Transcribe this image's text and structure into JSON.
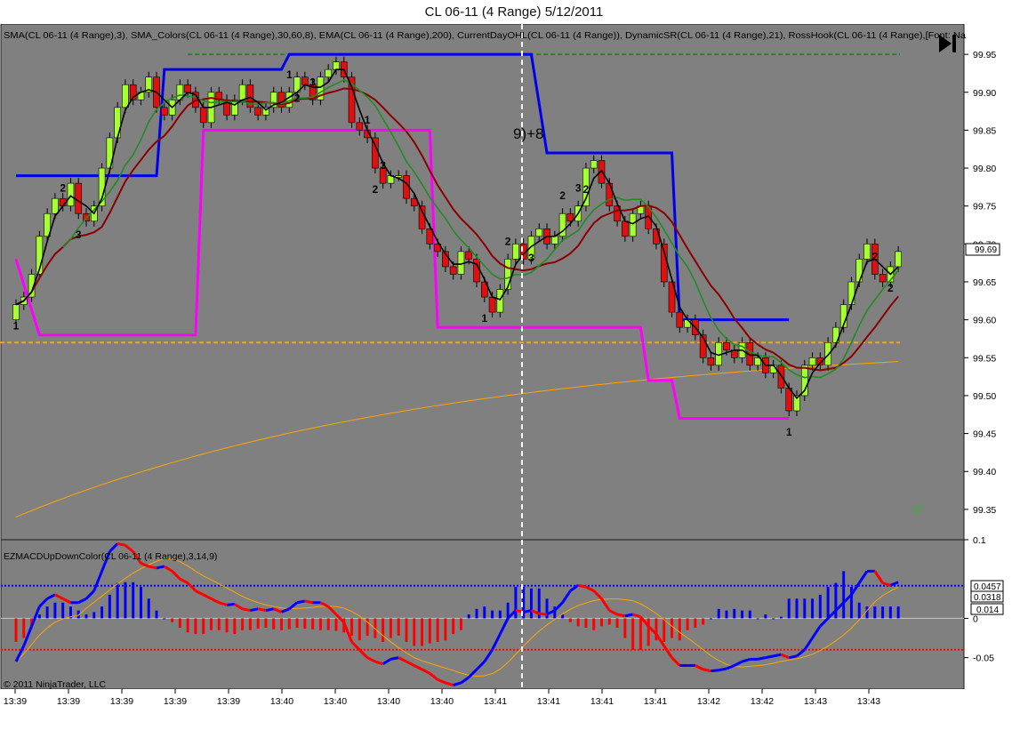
{
  "title": "CL 06-11 (4 Range)  5/12/2011",
  "price_panel": {
    "indicator_legend": "SMA(CL 06-11 (4 Range),3), SMA_Colors(CL 06-11 (4 Range),30,60,8), EMA(CL 06-11 (4 Range),200), CurrentDayOHL(CL 06-11 (4 Range)), DynamicSR(CL 06-11 (4 Range),21), RossHook(CL 06-11 (4 Range),[Font: Na",
    "play_icon": "skip-to-end-icon",
    "annotation": "9)+8",
    "corner_label": "0\"",
    "current_price": "99.69",
    "y_ticks": [
      "99.95",
      "99.90",
      "99.85",
      "99.80",
      "99.75",
      "99.70",
      "99.65",
      "99.60",
      "99.55",
      "99.50",
      "99.45",
      "99.40",
      "99.35"
    ]
  },
  "macd_panel": {
    "legend": "EZMACDUpDownColor(CL 06-11 (4 Range),3,14,9)",
    "copyright": "© 2011 NinjaTrader, LLC",
    "y_ticks": [
      "0.1",
      "0",
      "-0.05"
    ],
    "value_boxes": [
      "0.0457",
      "0.0318",
      "0.014"
    ]
  },
  "x_ticks": [
    "13:39",
    "13:39",
    "13:39",
    "13:39",
    "13:39",
    "13:40",
    "13:40",
    "13:40",
    "13:40",
    "13:41",
    "13:41",
    "13:41",
    "13:41",
    "13:42",
    "13:42",
    "13:43",
    "13:43"
  ],
  "colors": {
    "background": "#808080",
    "up_bar": "#a6ff2e",
    "down_bar": "#e01010",
    "sma_fast": "#000000",
    "sma_colors": "#ffffff",
    "ema200": "#ffa500",
    "day_high": "#228b22",
    "day_open": "#ffa500",
    "resistance": "#0000ee",
    "support": "#ff00ff",
    "macd": "#0000ff",
    "macd_down": "#ff0000"
  },
  "chart_data": {
    "type": "candlestick",
    "ylim": [
      99.31,
      99.99
    ],
    "closes": [
      99.62,
      99.63,
      99.66,
      99.71,
      99.74,
      99.76,
      99.75,
      99.78,
      99.74,
      99.73,
      99.75,
      99.8,
      99.84,
      99.88,
      99.91,
      99.89,
      99.9,
      99.92,
      99.88,
      99.87,
      99.89,
      99.91,
      99.9,
      99.88,
      99.86,
      99.9,
      99.89,
      99.87,
      99.89,
      99.91,
      99.88,
      99.87,
      99.88,
      99.9,
      99.88,
      99.9,
      99.92,
      99.91,
      99.89,
      99.92,
      99.93,
      99.94,
      99.92,
      99.86,
      99.85,
      99.84,
      99.8,
      99.78,
      99.79,
      99.79,
      99.76,
      99.75,
      99.72,
      99.7,
      99.69,
      99.67,
      99.66,
      99.69,
      99.68,
      99.65,
      99.63,
      99.61,
      99.64,
      99.68,
      99.7,
      99.68,
      99.71,
      99.72,
      99.7,
      99.71,
      99.74,
      99.73,
      99.75,
      99.8,
      99.81,
      99.78,
      99.75,
      99.73,
      99.71,
      99.74,
      99.75,
      99.72,
      99.7,
      99.65,
      99.61,
      99.59,
      99.6,
      99.58,
      99.55,
      99.54,
      99.57,
      99.56,
      99.55,
      99.57,
      99.54,
      99.55,
      99.53,
      99.54,
      99.51,
      99.48,
      99.5,
      99.54,
      99.55,
      99.54,
      99.57,
      99.59,
      99.62,
      99.65,
      99.68,
      99.7,
      99.66,
      99.65,
      99.67,
      99.69
    ],
    "series": [
      {
        "name": "SMA 3"
      },
      {
        "name": "SMA_Colors"
      },
      {
        "name": "EMA 200"
      },
      {
        "name": "DynamicSR resistance",
        "levels": [
          [
            0,
            99.79
          ],
          [
            18,
            99.79
          ],
          [
            19,
            99.93
          ],
          [
            34,
            99.93
          ],
          [
            35,
            99.95
          ],
          [
            66,
            99.95
          ],
          [
            68,
            99.82
          ],
          [
            84,
            99.82
          ],
          [
            85,
            99.6
          ],
          [
            99,
            99.6
          ]
        ]
      },
      {
        "name": "DynamicSR support",
        "levels": [
          [
            0,
            99.68
          ],
          [
            3,
            99.58
          ],
          [
            23,
            99.58
          ],
          [
            24,
            99.85
          ],
          [
            53,
            99.85
          ],
          [
            54,
            99.59
          ],
          [
            80,
            99.59
          ],
          [
            81,
            99.52
          ],
          [
            84,
            99.52
          ],
          [
            85,
            99.47
          ],
          [
            99,
            99.47
          ]
        ]
      },
      {
        "name": "Current day high",
        "value": 99.95
      },
      {
        "name": "Current day open",
        "value": 99.57
      }
    ],
    "rosshook_labels": [
      {
        "bar": 0,
        "text": "1",
        "pos": "below"
      },
      {
        "bar": 6,
        "text": "2",
        "pos": "above"
      },
      {
        "bar": 8,
        "text": "3",
        "pos": "below"
      },
      {
        "bar": 35,
        "text": "1",
        "pos": "above"
      },
      {
        "bar": 36,
        "text": "2",
        "pos": "below"
      },
      {
        "bar": 38,
        "text": "3",
        "pos": "above"
      },
      {
        "bar": 45,
        "text": "1",
        "pos": "above"
      },
      {
        "bar": 47,
        "text": "3",
        "pos": "above"
      },
      {
        "bar": 46,
        "text": "2",
        "pos": "below"
      },
      {
        "bar": 60,
        "text": "1",
        "pos": "below"
      },
      {
        "bar": 63,
        "text": "2",
        "pos": "above"
      },
      {
        "bar": 66,
        "text": "3",
        "pos": "below"
      },
      {
        "bar": 70,
        "text": "2",
        "pos": "above"
      },
      {
        "bar": 72,
        "text": "3",
        "pos": "above"
      },
      {
        "bar": 73,
        "text": "2",
        "pos": "below"
      },
      {
        "bar": 99,
        "text": "1",
        "pos": "below"
      },
      {
        "bar": 110,
        "text": "2",
        "pos": "above"
      },
      {
        "bar": 112,
        "text": "2",
        "pos": "below"
      }
    ],
    "macd": {
      "ylim": [
        -0.09,
        0.1
      ],
      "upper_level": 0.0415,
      "lower_level": -0.04,
      "line": [
        -0.055,
        -0.035,
        -0.01,
        0.015,
        0.025,
        0.03,
        0.025,
        0.02,
        0.02,
        0.025,
        0.035,
        0.06,
        0.085,
        0.095,
        0.093,
        0.085,
        0.07,
        0.066,
        0.064,
        0.066,
        0.06,
        0.05,
        0.045,
        0.035,
        0.03,
        0.025,
        0.02,
        0.017,
        0.018,
        0.012,
        0.01,
        0.012,
        0.01,
        0.012,
        0.008,
        0.012,
        0.02,
        0.022,
        0.02,
        0.02,
        0.015,
        0.005,
        -0.005,
        -0.03,
        -0.04,
        -0.05,
        -0.055,
        -0.058,
        -0.052,
        -0.05,
        -0.055,
        -0.06,
        -0.065,
        -0.07,
        -0.078,
        -0.082,
        -0.085,
        -0.082,
        -0.075,
        -0.065,
        -0.055,
        -0.04,
        -0.02,
        0.0,
        0.01,
        0.008,
        0.01,
        0.006,
        0.005,
        0.01,
        0.02,
        0.035,
        0.042,
        0.04,
        0.035,
        0.025,
        0.01,
        0.005,
        0.003,
        0.005,
        0.002,
        -0.01,
        -0.02,
        -0.035,
        -0.05,
        -0.06,
        -0.06,
        -0.06,
        -0.065,
        -0.067,
        -0.066,
        -0.064,
        -0.06,
        -0.055,
        -0.052,
        -0.052,
        -0.05,
        -0.048,
        -0.046,
        -0.05,
        -0.048,
        -0.04,
        -0.025,
        -0.01,
        0.0,
        0.01,
        0.02,
        0.03,
        0.045,
        0.06,
        0.06,
        0.045,
        0.042,
        0.046
      ],
      "histogram": [
        -0.03,
        -0.025,
        -0.01,
        0.005,
        0.015,
        0.02,
        0.02,
        0.015,
        0.01,
        0.005,
        0.008,
        0.015,
        0.03,
        0.045,
        0.046,
        0.046,
        0.04,
        0.025,
        0.01,
        0.0,
        -0.005,
        -0.012,
        -0.018,
        -0.02,
        -0.02,
        -0.015,
        -0.015,
        -0.018,
        -0.02,
        -0.015,
        -0.015,
        -0.013,
        -0.012,
        -0.014,
        -0.015,
        -0.014,
        -0.012,
        -0.013,
        -0.014,
        -0.015,
        -0.015,
        -0.016,
        -0.018,
        -0.022,
        -0.028,
        -0.022,
        -0.025,
        -0.03,
        -0.025,
        -0.022,
        -0.03,
        -0.035,
        -0.035,
        -0.032,
        -0.03,
        -0.028,
        -0.02,
        -0.015,
        0.005,
        0.012,
        0.015,
        0.01,
        0.01,
        0.02,
        0.04,
        0.04,
        0.038,
        0.038,
        0.025,
        0.015,
        0.005,
        -0.005,
        -0.01,
        -0.012,
        -0.015,
        -0.01,
        -0.008,
        -0.012,
        -0.025,
        -0.04,
        -0.04,
        -0.035,
        -0.028,
        -0.03,
        -0.025,
        -0.028,
        -0.015,
        -0.012,
        -0.008,
        0.0,
        0.012,
        0.01,
        0.012,
        0.01,
        0.01,
        0.0,
        0.005,
        0.0,
        0.002,
        0.025,
        0.025,
        0.025,
        0.025,
        0.03,
        0.04,
        0.045,
        0.06,
        0.04,
        0.02,
        0.015,
        0.015,
        0.015,
        0.015,
        0.015
      ]
    }
  }
}
